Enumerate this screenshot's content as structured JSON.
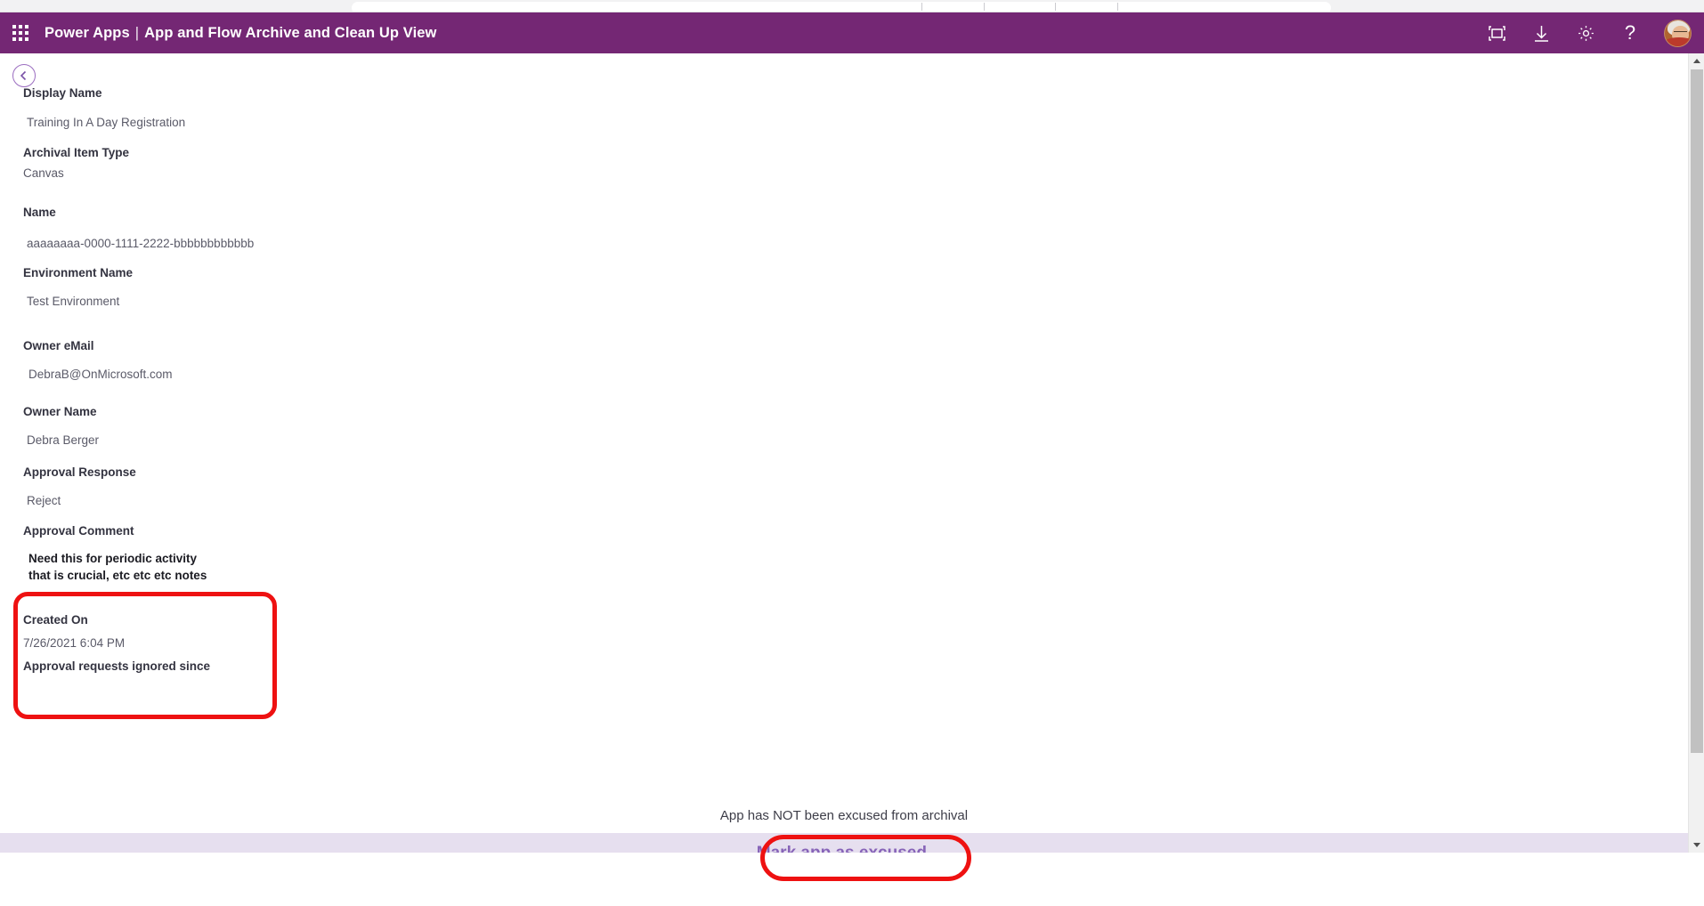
{
  "browser": {
    "chrome_visible": true
  },
  "header": {
    "waffle_label": "app-launcher",
    "product": "Power Apps",
    "separator": "|",
    "app_title": "App and Flow Archive and Clean Up View",
    "actions": [
      {
        "name": "fullscreen-icon",
        "label": "Full screen"
      },
      {
        "name": "download-icon",
        "label": "Download"
      },
      {
        "name": "gear-icon",
        "label": "Settings"
      },
      {
        "name": "help-icon",
        "label": "?"
      }
    ],
    "avatar_label": "User account"
  },
  "nav": {
    "back_label": "Back"
  },
  "form": {
    "fields": [
      {
        "label": "Display Name",
        "value": "Training In A Day Registration"
      },
      {
        "label": "Archival Item Type",
        "value": "Canvas"
      },
      {
        "label": "Name",
        "value": "aaaaaaaa-0000-1111-2222-bbbbbbbbbbbb"
      },
      {
        "label": "Environment Name",
        "value": "Test Environment"
      },
      {
        "label": "Owner eMail",
        "value": "DebraB@OnMicrosoft.com"
      },
      {
        "label": "Owner Name",
        "value": "Debra Berger"
      },
      {
        "label": "Approval Response",
        "value": "Reject"
      },
      {
        "label": "Approval Comment",
        "value": "Need this for periodic activity that is crucial, etc etc etc notes"
      },
      {
        "label": "Created On",
        "value": "7/26/2021 6:04 PM"
      },
      {
        "label": "Approval requests ignored since",
        "value": ""
      }
    ]
  },
  "status": {
    "text": "App has NOT been excused from archival"
  },
  "command_bar": {
    "excuse_label": "Mark app as excused."
  },
  "scrollbar": {
    "up_label": "Scroll up",
    "down_label": "Scroll down",
    "thumb_label": "Scroll thumb"
  },
  "annotations": [
    {
      "name": "approval-comment-highlight",
      "color": "#ee1111"
    },
    {
      "name": "mark-excused-highlight",
      "color": "#ee1111"
    }
  ],
  "colors": {
    "header_purple": "#742774",
    "command_bar": "#e6dfef",
    "button_purple": "#8764b8",
    "annotation_red": "#ee1111"
  }
}
